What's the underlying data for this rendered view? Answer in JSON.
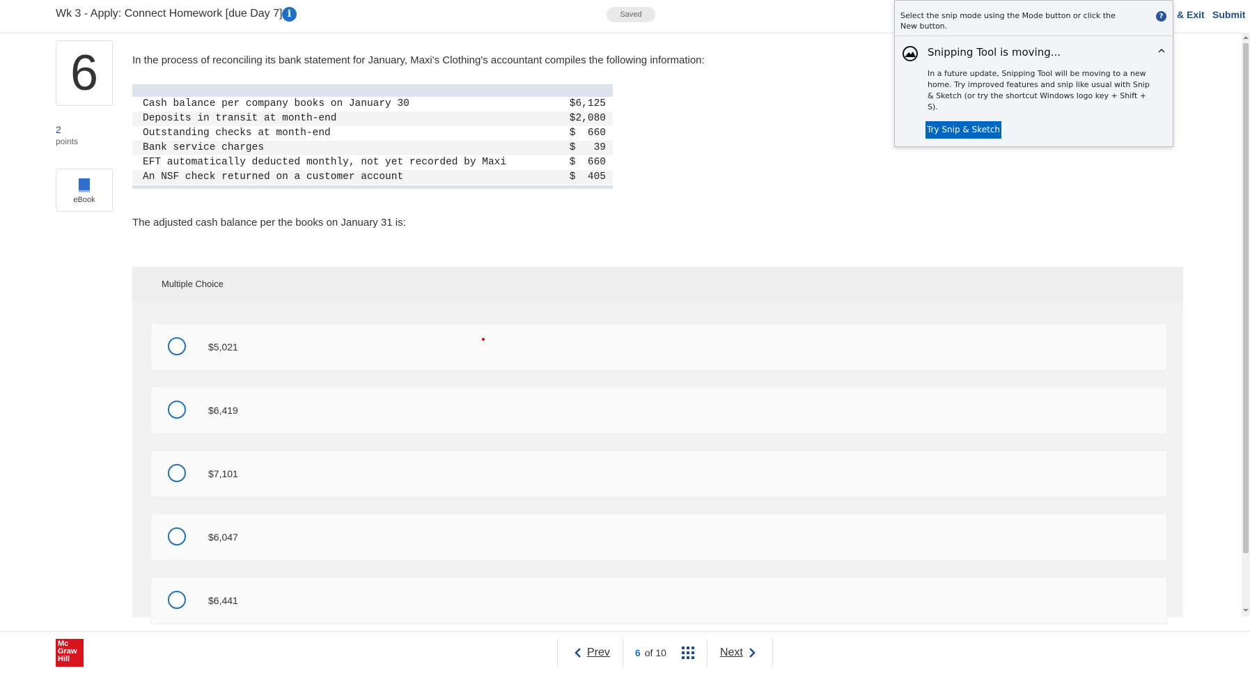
{
  "header": {
    "assignment_title": "Wk 3 - Apply: Connect Homework [due Day 7]",
    "saved_label": "Saved",
    "exit_label": "& Exit",
    "submit_label": "Submit"
  },
  "question": {
    "number": "6",
    "points_value": "2",
    "points_label": "points",
    "ebook_label": "eBook",
    "prompt": "In the process of reconciling its bank statement for January, Maxi's Clothing's accountant compiles the following information:",
    "table_rows": [
      {
        "label": "Cash balance per company books on January 30",
        "amount": "$6,125"
      },
      {
        "label": "Deposits in transit at month-end",
        "amount": "$2,080"
      },
      {
        "label": "Outstanding checks at month-end",
        "amount": "$  660"
      },
      {
        "label": "Bank service charges",
        "amount": "$   39"
      },
      {
        "label": "EFT automatically deducted monthly, not yet recorded by Maxi",
        "amount": "$  660"
      },
      {
        "label": "An NSF check returned on a customer account",
        "amount": "$  405"
      }
    ],
    "question_text": "The adjusted cash balance per the books on January 31 is:"
  },
  "answers": {
    "header_label": "Multiple Choice",
    "choices": [
      {
        "label": "$5,021"
      },
      {
        "label": "$6,419"
      },
      {
        "label": "$7,101"
      },
      {
        "label": "$6,047"
      },
      {
        "label": "$6,441"
      }
    ]
  },
  "snipping_tool": {
    "instructions": "Select the snip mode using the Mode button or click the New button.",
    "title": "Snipping Tool is moving...",
    "body": "In a future update, Snipping Tool will be moving to a new home. Try improved features and snip like usual with Snip & Sketch (or try the shortcut Windows logo key + Shift + S).",
    "button_label": "Try Snip & Sketch"
  },
  "footer": {
    "logo_lines": [
      "Mc",
      "Graw",
      "Hill"
    ],
    "prev_label": "Prev",
    "current_page": "6",
    "of_label": "of",
    "total_pages": "10",
    "next_label": "Next"
  },
  "colors": {
    "accent": "#1f6fc5",
    "brand_red": "#d9141c",
    "snip_button": "#0067c0"
  }
}
